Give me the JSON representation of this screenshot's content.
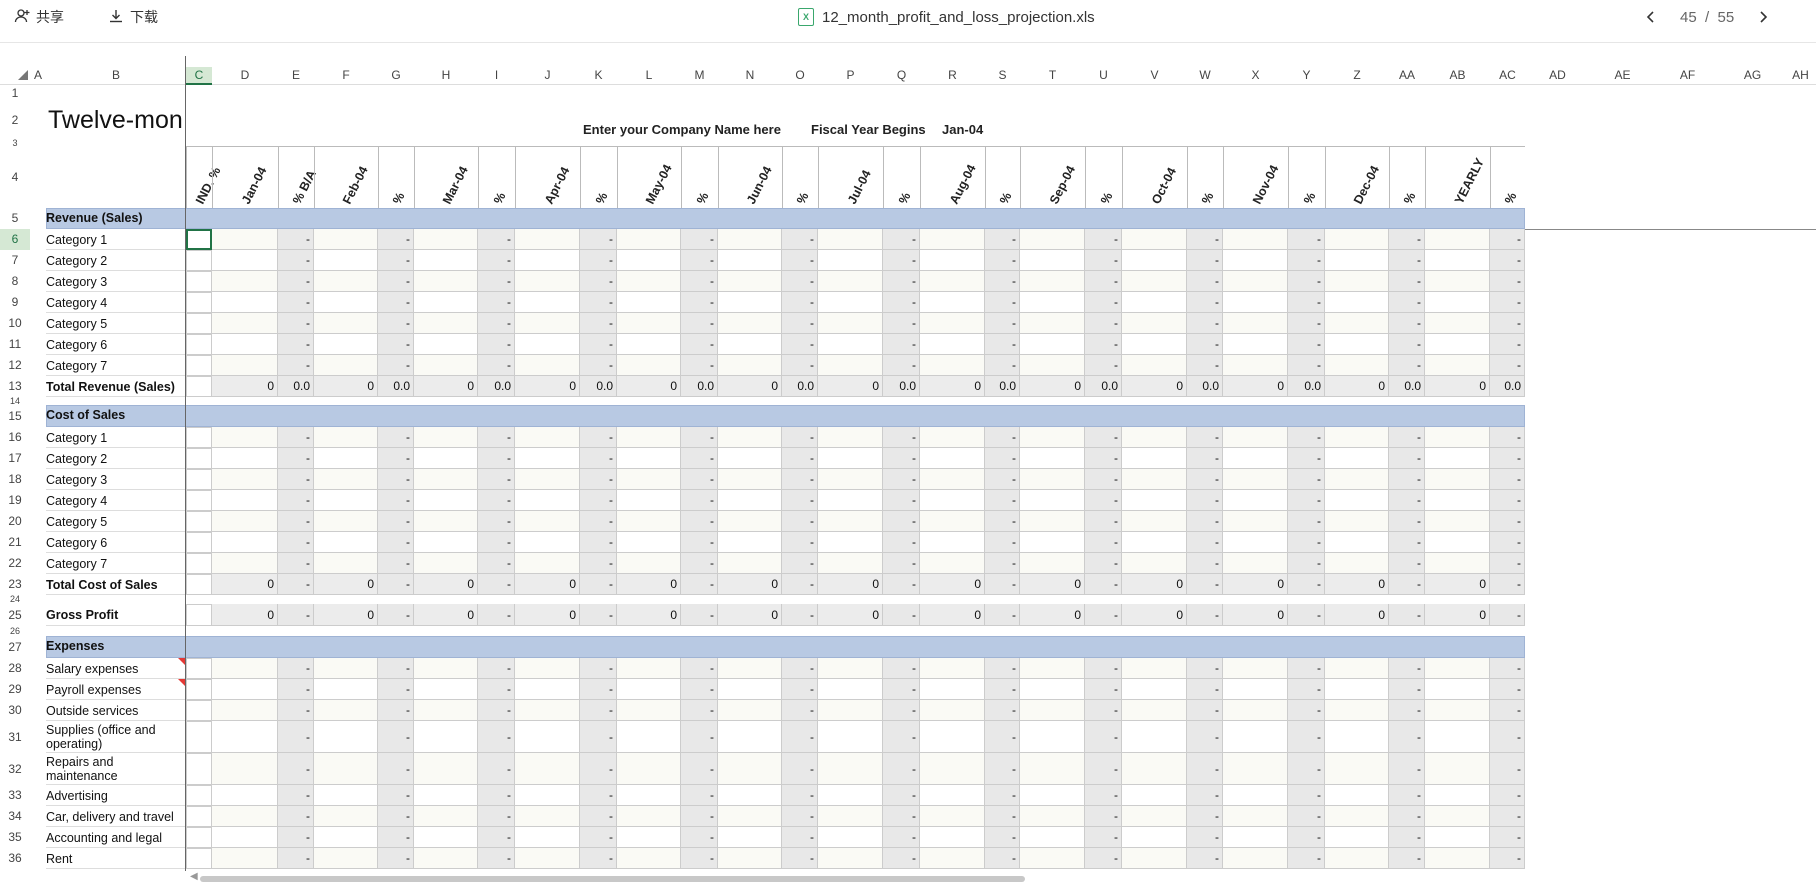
{
  "toolbar": {
    "share_label": "共享",
    "download_label": "下载",
    "file_name": "12_month_profit_and_loss_projection.xls",
    "page_current": "45",
    "page_sep": "/",
    "page_total": "55"
  },
  "columns": [
    "A",
    "B",
    "C",
    "D",
    "E",
    "F",
    "G",
    "H",
    "I",
    "J",
    "K",
    "L",
    "M",
    "N",
    "O",
    "P",
    "Q",
    "R",
    "S",
    "T",
    "U",
    "V",
    "W",
    "X",
    "Y",
    "Z",
    "AA",
    "AB",
    "AC",
    "AD",
    "AE",
    "AF",
    "AG",
    "AH"
  ],
  "header_row2": {
    "title": "Twelve-mon",
    "company": "Enter your Company Name here",
    "fiscal_label": "Fiscal Year Begins",
    "fiscal_value": "Jan-04"
  },
  "rotated_headers": [
    "IND. %",
    "Jan-04",
    "% B/A",
    "Feb-04",
    "%",
    "Mar-04",
    "%",
    "Apr-04",
    "%",
    "May-04",
    "%",
    "Jun-04",
    "%",
    "Jul-04",
    "%",
    "Aug-04",
    "%",
    "Sep-04",
    "%",
    "Oct-04",
    "%",
    "Nov-04",
    "%",
    "Dec-04",
    "%",
    "YEARLY",
    "%"
  ],
  "rows": [
    {
      "n": "1"
    },
    {
      "n": "2"
    },
    {
      "n": "3"
    },
    {
      "n": "4"
    },
    {
      "n": "5",
      "label": "Revenue (Sales)",
      "type": "section"
    },
    {
      "n": "6",
      "label": "Category 1",
      "type": "data"
    },
    {
      "n": "7",
      "label": "Category 2",
      "type": "data"
    },
    {
      "n": "8",
      "label": "Category 3",
      "type": "data"
    },
    {
      "n": "9",
      "label": "Category 4",
      "type": "data"
    },
    {
      "n": "10",
      "label": "Category 5",
      "type": "data"
    },
    {
      "n": "11",
      "label": "Category 6",
      "type": "data"
    },
    {
      "n": "12",
      "label": "Category 7",
      "type": "data"
    },
    {
      "n": "13",
      "label": "Total Revenue (Sales)",
      "type": "total",
      "val": "0",
      "pct": "0.0"
    },
    {
      "n": "14"
    },
    {
      "n": "15",
      "label": "Cost of Sales",
      "type": "section"
    },
    {
      "n": "16",
      "label": "Category 1",
      "type": "data"
    },
    {
      "n": "17",
      "label": "Category 2",
      "type": "data"
    },
    {
      "n": "18",
      "label": "Category 3",
      "type": "data"
    },
    {
      "n": "19",
      "label": "Category 4",
      "type": "data"
    },
    {
      "n": "20",
      "label": "Category 5",
      "type": "data"
    },
    {
      "n": "21",
      "label": "Category 6",
      "type": "data"
    },
    {
      "n": "22",
      "label": "Category 7",
      "type": "data"
    },
    {
      "n": "23",
      "label": "Total Cost of Sales",
      "type": "total",
      "val": "0",
      "pct": "-"
    },
    {
      "n": "24"
    },
    {
      "n": "25",
      "label": "Gross Profit",
      "type": "total",
      "val": "0",
      "pct": "-"
    },
    {
      "n": "26"
    },
    {
      "n": "27",
      "label": "Expenses",
      "type": "section"
    },
    {
      "n": "28",
      "label": "Salary expenses",
      "type": "data",
      "comment": true
    },
    {
      "n": "29",
      "label": "Payroll expenses",
      "type": "data",
      "comment": true
    },
    {
      "n": "30",
      "label": "Outside services",
      "type": "data"
    },
    {
      "n": "31",
      "label": "Supplies (office and operating)",
      "type": "data",
      "tall": true
    },
    {
      "n": "32",
      "label": "Repairs and maintenance",
      "type": "data",
      "tall": true
    },
    {
      "n": "33",
      "label": "Advertising",
      "type": "data"
    },
    {
      "n": "34",
      "label": "Car, delivery and travel",
      "type": "data"
    },
    {
      "n": "35",
      "label": "Accounting and legal",
      "type": "data"
    },
    {
      "n": "36",
      "label": "Rent",
      "type": "data"
    }
  ],
  "dash": "-",
  "colors": {
    "section": "#b8c9e3",
    "selection": "#217346",
    "pct_col": "#e8e8e8",
    "comment": "#e53935"
  }
}
